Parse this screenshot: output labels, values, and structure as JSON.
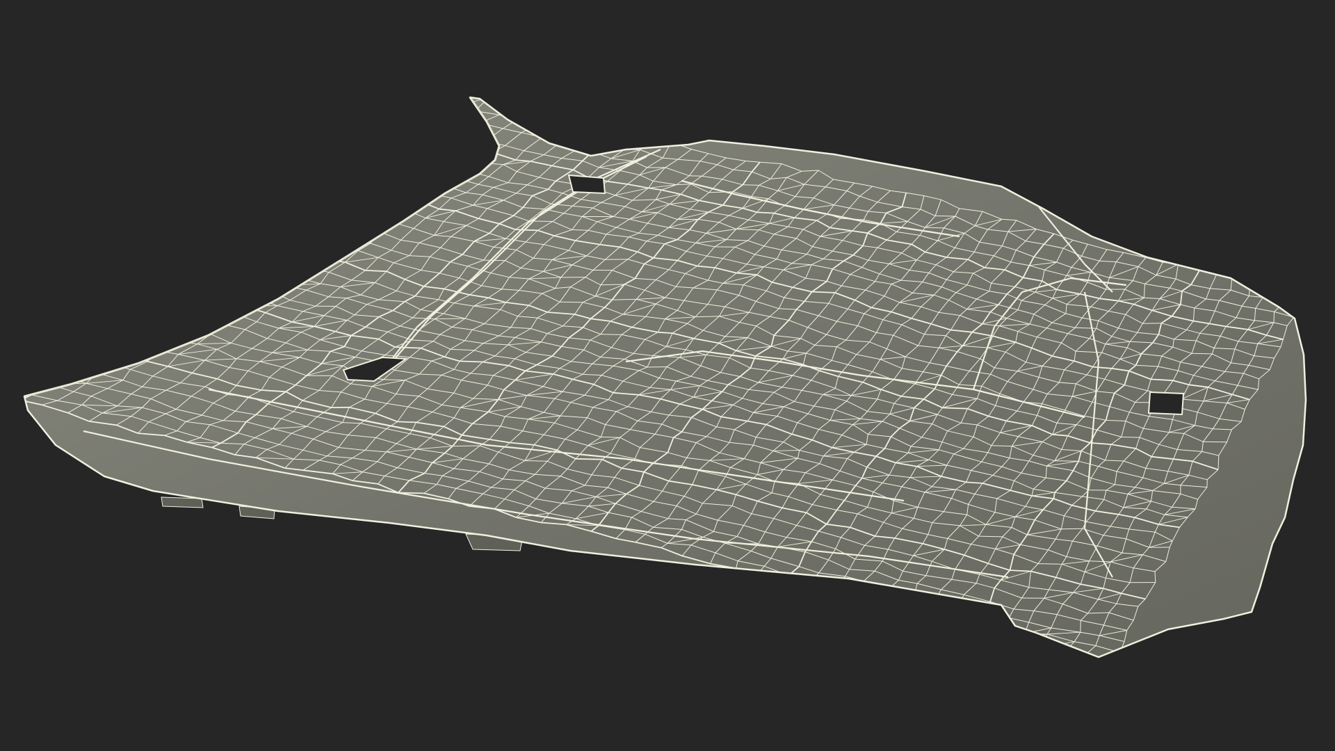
{
  "viewport": {
    "background_color": "#262626",
    "model_fill_color": "#72736a",
    "model_shade_color": "#8a8b80",
    "model_dark_color": "#5f6058",
    "wireframe_color": "#f1f0df",
    "cutout_color": "#262626"
  }
}
